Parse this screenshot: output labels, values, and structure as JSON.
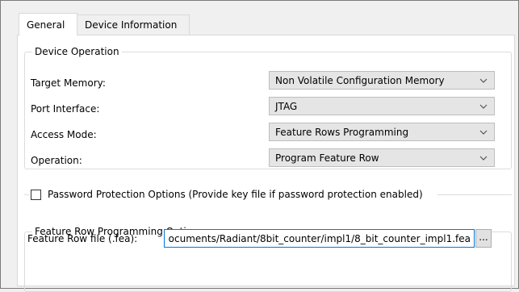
{
  "tabs": {
    "general": "General",
    "device_information": "Device Information"
  },
  "device_operation": {
    "title": "Device Operation",
    "target_memory": {
      "label": "Target Memory:",
      "value": "Non Volatile Configuration Memory"
    },
    "port_interface": {
      "label": "Port Interface:",
      "value": "JTAG"
    },
    "access_mode": {
      "label": "Access Mode:",
      "value": "Feature Rows Programming"
    },
    "operation": {
      "label": "Operation:",
      "value": "Program Feature Row"
    }
  },
  "password_protection": {
    "label": "Password Protection Options (Provide key file if password protection enabled)",
    "checked": false
  },
  "feature_row": {
    "title": "Feature Row Programming Options",
    "file_label": "Feature Row file (.fea):",
    "file_value": "ocuments/Radiant/8bit_counter/impl1/8_bit_counter_impl1.fea",
    "browse_label": "..."
  },
  "icons": {
    "dropdown": "chevron-down-icon"
  }
}
